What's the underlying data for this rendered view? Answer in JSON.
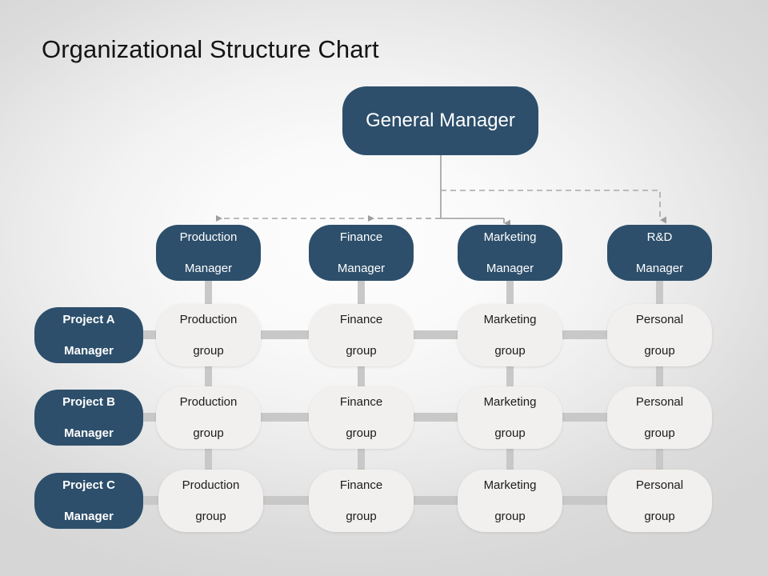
{
  "title": "Organizational Structure Chart",
  "colors": {
    "node_dark": "#2d4f6b",
    "node_light": "#f2f0ee",
    "connector_bar": "#c8c8c8",
    "connector_line": "#a0a0a0",
    "title_text": "#141414",
    "dark_node_text": "#ffffff",
    "light_node_text": "#1c1c1c",
    "background_center": "#fdfdfd",
    "background_edge": "#d6d6d6"
  },
  "chart_data": {
    "type": "org-chart",
    "title": "Organizational Structure Chart",
    "root": {
      "label": "General Manager",
      "style": "dark"
    },
    "managers": [
      {
        "label": "Production Manager",
        "line1": "Production",
        "line2": "Manager",
        "style": "dark"
      },
      {
        "label": "Finance Manager",
        "line1": "Finance",
        "line2": "Manager",
        "style": "dark"
      },
      {
        "label": "Marketing Manager",
        "line1": "Marketing",
        "line2": "Manager",
        "style": "dark"
      },
      {
        "label": "R&D Manager",
        "line1": "R&D",
        "line2": "Manager",
        "style": "dark"
      }
    ],
    "projects": [
      {
        "label": "Project A Manager",
        "line1": "Project A",
        "line2": "Manager",
        "style": "dark"
      },
      {
        "label": "Project B Manager",
        "line1": "Project B",
        "line2": "Manager",
        "style": "dark"
      },
      {
        "label": "Project C Manager",
        "line1": "Project C",
        "line2": "Manager",
        "style": "dark"
      }
    ],
    "groups": [
      [
        {
          "line1": "Production",
          "line2": "group"
        },
        {
          "line1": "Finance",
          "line2": "group"
        },
        {
          "line1": "Marketing",
          "line2": "group"
        },
        {
          "line1": "Personal",
          "line2": "group"
        }
      ],
      [
        {
          "line1": "Production",
          "line2": "group"
        },
        {
          "line1": "Finance",
          "line2": "group"
        },
        {
          "line1": "Marketing",
          "line2": "group"
        },
        {
          "line1": "Personal",
          "line2": "group"
        }
      ],
      [
        {
          "line1": "Production",
          "line2": "group"
        },
        {
          "line1": "Finance",
          "line2": "group"
        },
        {
          "line1": "Marketing",
          "line2": "group"
        },
        {
          "line1": "Personal",
          "line2": "group"
        }
      ]
    ],
    "connector_styles": {
      "root_to_managers": "dashed-with-arrowheads",
      "matrix_grid": "solid-thick-grey-bars"
    }
  }
}
